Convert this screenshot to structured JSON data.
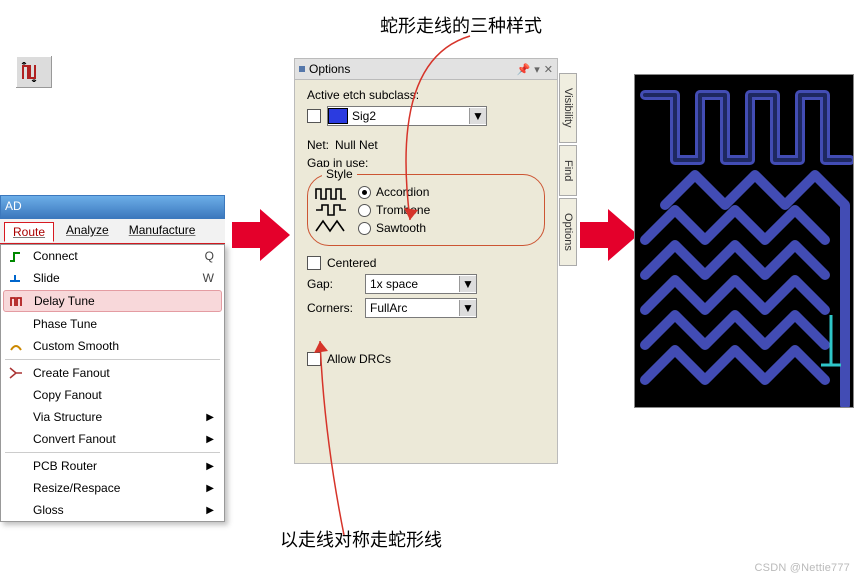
{
  "annotations": {
    "top": "蛇形走线的三种样式",
    "bottom": "以走线对称走蛇形线"
  },
  "watermark": "CSDN @Nettie777",
  "titlebar_fragment": "AD",
  "menubar": {
    "route": "Route",
    "analyze": "Analyze",
    "manufacture": "Manufacture"
  },
  "route_menu": {
    "items": [
      {
        "label": "Connect",
        "shortcut": "Q",
        "icon": "connect"
      },
      {
        "label": "Slide",
        "shortcut": "W",
        "icon": "slide"
      },
      {
        "label": "Delay Tune",
        "icon": "delay",
        "highlight": true
      },
      {
        "label": "Phase Tune",
        "icon": ""
      },
      {
        "label": "Custom Smooth",
        "icon": "smooth"
      },
      {
        "sep": true
      },
      {
        "label": "Create Fanout",
        "icon": "fanout"
      },
      {
        "label": "Copy Fanout",
        "icon": ""
      },
      {
        "label": "Via Structure",
        "submenu": true
      },
      {
        "label": "Convert Fanout",
        "submenu": true
      },
      {
        "sep": true
      },
      {
        "label": "PCB Router",
        "submenu": true
      },
      {
        "label": "Resize/Respace",
        "submenu": true
      },
      {
        "label": "Gloss",
        "submenu": true
      }
    ]
  },
  "options": {
    "panel_title": "Options",
    "active_label": "Active etch subclass:",
    "subclass_value": "Sig2",
    "net_label": "Net:",
    "net_value": "Null Net",
    "gap_in_use_label": "Gap in use:",
    "style_label": "Style",
    "style_radios": {
      "accordion": "Accordion",
      "trombone": "Trombone",
      "sawtooth": "Sawtooth",
      "selected": "accordion"
    },
    "centered_label": "Centered",
    "centered_checked": false,
    "gap_label": "Gap:",
    "gap_value": "1x space",
    "corners_label": "Corners:",
    "corners_value": "FullArc",
    "allow_drc_label": "Allow DRCs",
    "side_tabs": [
      "Visibility",
      "Find",
      "Options"
    ]
  }
}
